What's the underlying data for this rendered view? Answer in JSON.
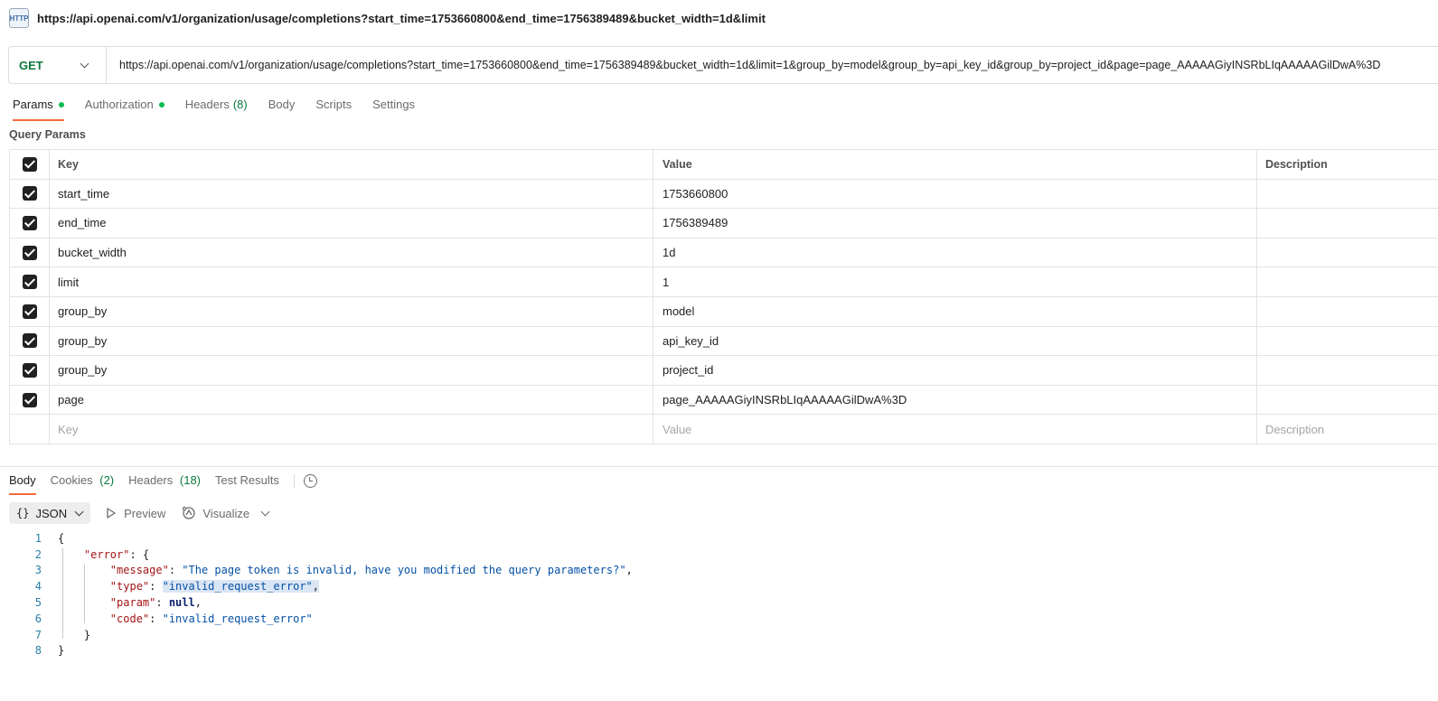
{
  "title_bar": {
    "icon": "http-icon",
    "icon_text": "HTTP",
    "title": "https://api.openai.com/v1/organization/usage/completions?start_time=1753660800&end_time=1756389489&bucket_width=1d&limit"
  },
  "request": {
    "method": "GET",
    "url": "https://api.openai.com/v1/organization/usage/completions?start_time=1753660800&end_time=1756389489&bucket_width=1d&limit=1&group_by=model&group_by=api_key_id&group_by=project_id&page=page_AAAAAGiyINSRbLIqAAAAAGilDwA%3D"
  },
  "request_tabs": [
    {
      "label": "Params",
      "dot": true,
      "count": "",
      "active": true
    },
    {
      "label": "Authorization",
      "dot": true,
      "count": "",
      "active": false
    },
    {
      "label": "Headers",
      "dot": false,
      "count": "(8)",
      "active": false
    },
    {
      "label": "Body",
      "dot": false,
      "count": "",
      "active": false
    },
    {
      "label": "Scripts",
      "dot": false,
      "count": "",
      "active": false
    },
    {
      "label": "Settings",
      "dot": false,
      "count": "",
      "active": false
    }
  ],
  "query_params": {
    "section_label": "Query Params",
    "headers": {
      "key": "Key",
      "value": "Value",
      "description": "Description"
    },
    "rows": [
      {
        "key": "start_time",
        "value": "1753660800",
        "description": ""
      },
      {
        "key": "end_time",
        "value": "1756389489",
        "description": ""
      },
      {
        "key": "bucket_width",
        "value": "1d",
        "description": ""
      },
      {
        "key": "limit",
        "value": "1",
        "description": ""
      },
      {
        "key": "group_by",
        "value": "model",
        "description": ""
      },
      {
        "key": "group_by",
        "value": "api_key_id",
        "description": ""
      },
      {
        "key": "group_by",
        "value": "project_id",
        "description": ""
      },
      {
        "key": "page",
        "value": "page_AAAAAGiyINSRbLIqAAAAAGilDwA%3D",
        "description": ""
      }
    ],
    "placeholders": {
      "key": "Key",
      "value": "Value",
      "description": "Description"
    }
  },
  "response_tabs": [
    {
      "label": "Body",
      "count": "",
      "active": true
    },
    {
      "label": "Cookies",
      "count": "(2)",
      "active": false
    },
    {
      "label": "Headers",
      "count": "(18)",
      "active": false
    },
    {
      "label": "Test Results",
      "count": "",
      "active": false
    }
  ],
  "response_toolbar": {
    "format": "JSON",
    "format_icon": "{}",
    "preview": "Preview",
    "visualize": "Visualize"
  },
  "response_body": {
    "line_numbers": [
      "1",
      "2",
      "3",
      "4",
      "5",
      "6",
      "7",
      "8"
    ],
    "open_brace": "{",
    "error_key": "\"error\"",
    "message_key": "\"message\"",
    "message_value": "\"The page token is invalid, have you modified the query parameters?\"",
    "type_key": "\"type\"",
    "type_value": "\"invalid_request_error\"",
    "param_key": "\"param\"",
    "param_value": "null",
    "code_key": "\"code\"",
    "code_value": "\"invalid_request_error\"",
    "close_inner": "}",
    "close_brace": "}"
  },
  "colors": {
    "method_get": "#0c7a3d",
    "active_tab_underline": "#f26b3a",
    "status_dot": "#0cbb52",
    "json_key": "#a31515",
    "json_string": "#0451a5",
    "line_number": "#2a7fa8"
  }
}
